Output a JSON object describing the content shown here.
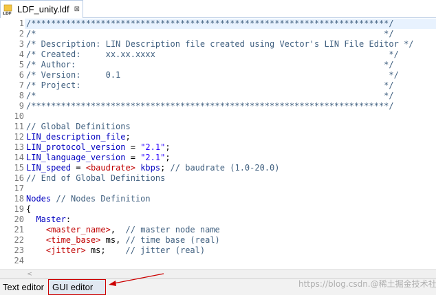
{
  "tab": {
    "title": "LDF_unity.ldf",
    "close_glyph": "⊠",
    "icon": "ldf-file-icon"
  },
  "editor": {
    "lines": [
      {
        "n": "1",
        "parts": [
          {
            "c": "comment",
            "t": "/************************************************************************/"
          }
        ]
      },
      {
        "n": "2",
        "parts": [
          {
            "c": "comment",
            "t": "/*                                                                      */"
          }
        ]
      },
      {
        "n": "3",
        "parts": [
          {
            "c": "comment",
            "t": "/* Description: LIN Description file created using Vector's LIN File Editor */"
          }
        ]
      },
      {
        "n": "4",
        "parts": [
          {
            "c": "comment",
            "t": "/* Created:     xx.xx.xxxx                                               */"
          }
        ]
      },
      {
        "n": "5",
        "parts": [
          {
            "c": "comment",
            "t": "/* Author:                                                              */"
          }
        ]
      },
      {
        "n": "6",
        "parts": [
          {
            "c": "comment",
            "t": "/* Version:     0.1                                                      */"
          }
        ]
      },
      {
        "n": "7",
        "parts": [
          {
            "c": "comment",
            "t": "/* Project:                                                             */"
          }
        ]
      },
      {
        "n": "8",
        "parts": [
          {
            "c": "comment",
            "t": "/*                                                                      */"
          }
        ]
      },
      {
        "n": "9",
        "parts": [
          {
            "c": "comment",
            "t": "/************************************************************************/"
          }
        ]
      },
      {
        "n": "10",
        "parts": []
      },
      {
        "n": "11",
        "parts": [
          {
            "c": "comment",
            "t": "// Global Definitions"
          }
        ]
      },
      {
        "n": "12",
        "parts": [
          {
            "c": "key",
            "t": "LIN_description_file"
          },
          {
            "c": "text",
            "t": ";"
          }
        ]
      },
      {
        "n": "13",
        "parts": [
          {
            "c": "key",
            "t": "LIN_protocol_version"
          },
          {
            "c": "text",
            "t": " = "
          },
          {
            "c": "str",
            "t": "\"2.1\""
          },
          {
            "c": "text",
            "t": ";"
          }
        ]
      },
      {
        "n": "14",
        "parts": [
          {
            "c": "key",
            "t": "LIN_language_version"
          },
          {
            "c": "text",
            "t": " = "
          },
          {
            "c": "str",
            "t": "\"2.1\""
          },
          {
            "c": "text",
            "t": ";"
          }
        ]
      },
      {
        "n": "15",
        "parts": [
          {
            "c": "key",
            "t": "LIN_speed"
          },
          {
            "c": "text",
            "t": " = "
          },
          {
            "c": "param",
            "t": "<baudrate>"
          },
          {
            "c": "key",
            "t": " kbps"
          },
          {
            "c": "text",
            "t": "; "
          },
          {
            "c": "comment",
            "t": "// baudrate (1.0-20.0)"
          }
        ]
      },
      {
        "n": "16",
        "parts": [
          {
            "c": "comment",
            "t": "// End of Global Definitions"
          }
        ]
      },
      {
        "n": "17",
        "parts": []
      },
      {
        "n": "18",
        "parts": [
          {
            "c": "key",
            "t": "Nodes"
          },
          {
            "c": "text",
            "t": " "
          },
          {
            "c": "comment",
            "t": "// Nodes Definition"
          }
        ]
      },
      {
        "n": "19",
        "parts": [
          {
            "c": "text",
            "t": "{"
          }
        ]
      },
      {
        "n": "20",
        "parts": [
          {
            "c": "text",
            "t": "  "
          },
          {
            "c": "key",
            "t": "Master"
          },
          {
            "c": "text",
            "t": ":"
          }
        ]
      },
      {
        "n": "21",
        "parts": [
          {
            "c": "text",
            "t": "    "
          },
          {
            "c": "param",
            "t": "<master_name>"
          },
          {
            "c": "text",
            "t": ",  "
          },
          {
            "c": "comment",
            "t": "// master node name"
          }
        ]
      },
      {
        "n": "22",
        "parts": [
          {
            "c": "text",
            "t": "    "
          },
          {
            "c": "param",
            "t": "<time_base>"
          },
          {
            "c": "text",
            "t": " ms, "
          },
          {
            "c": "comment",
            "t": "// time base (real)"
          }
        ]
      },
      {
        "n": "23",
        "parts": [
          {
            "c": "text",
            "t": "    "
          },
          {
            "c": "param",
            "t": "<jitter>"
          },
          {
            "c": "text",
            "t": " ms;    "
          },
          {
            "c": "comment",
            "t": "// jitter (real)"
          }
        ]
      },
      {
        "n": "24",
        "parts": []
      }
    ]
  },
  "scrollbar": {
    "left_arrow": "<"
  },
  "bottom_tabs": {
    "text_editor": "Text editor",
    "gui_editor": "GUI editor"
  },
  "watermark": "https://blog.csdn.@稀土掘金技术社区",
  "colors": {
    "comment": "#3f5f7f",
    "keyword": "#0000c0",
    "string": "#2a00ff",
    "param": "#c00000",
    "annotation": "#cc0000"
  }
}
